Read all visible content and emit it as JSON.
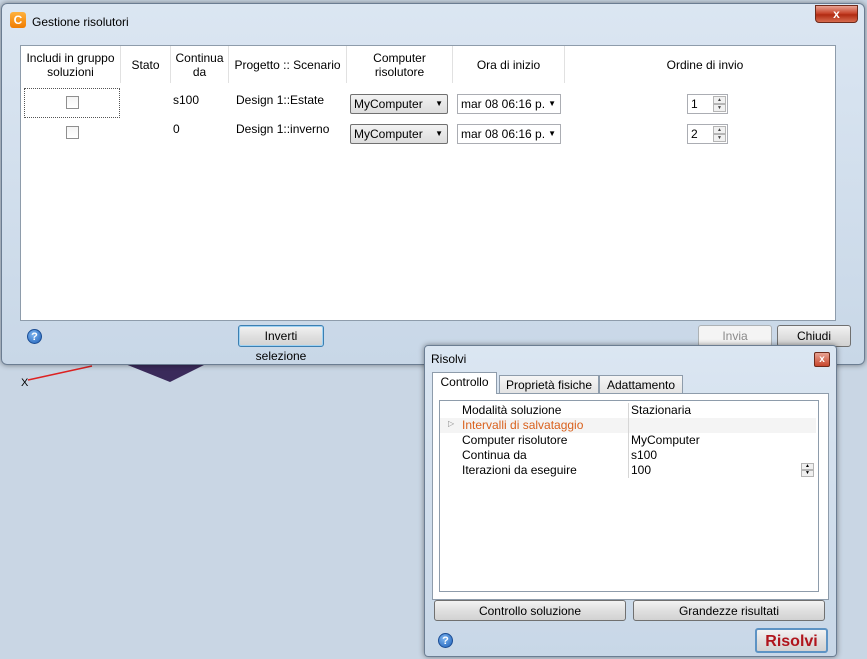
{
  "main_window": {
    "title": "Gestione risolutori",
    "close_glyph": "x",
    "columns": [
      "Includi in gruppo soluzioni",
      "Stato",
      "Continua da",
      "Progetto :: Scenario",
      "Computer risolutore",
      "Ora di inizio",
      "Ordine di invio"
    ],
    "rows": [
      {
        "include": false,
        "stato": "",
        "continua_da": "s100",
        "progetto": "Design 1::Estate",
        "computer": "MyComputer",
        "ora": "mar 08 06:16 p.",
        "ordine": "1"
      },
      {
        "include": false,
        "stato": "",
        "continua_da": "0",
        "progetto": "Design 1::inverno",
        "computer": "MyComputer",
        "ora": "mar 08 06:16 p.",
        "ordine": "2"
      }
    ],
    "invert_button": "Inverti selezione",
    "send_button": "Invia",
    "close_button": "Chiudi"
  },
  "solve_window": {
    "title": "Risolvi",
    "close_glyph": "x",
    "tabs": [
      "Controllo",
      "Proprietà fisiche",
      "Adattamento"
    ],
    "properties": [
      {
        "name": "Modalità soluzione",
        "value": "Stazionaria",
        "color": "#000000"
      },
      {
        "name": "Intervalli di salvataggio",
        "value": "",
        "color": "#d9611d"
      },
      {
        "name": "Computer risolutore",
        "value": "MyComputer",
        "color": "#000000"
      },
      {
        "name": "Continua da",
        "value": "s100",
        "color": "#000000"
      },
      {
        "name": "Iterazioni da eseguire",
        "value": "100",
        "color": "#000000"
      }
    ],
    "control_button": "Controllo soluzione",
    "results_button": "Grandezze risultati",
    "solve_button": "Risolvi",
    "solve_color": "#b0151c"
  },
  "background": {
    "axis_label": "X"
  }
}
